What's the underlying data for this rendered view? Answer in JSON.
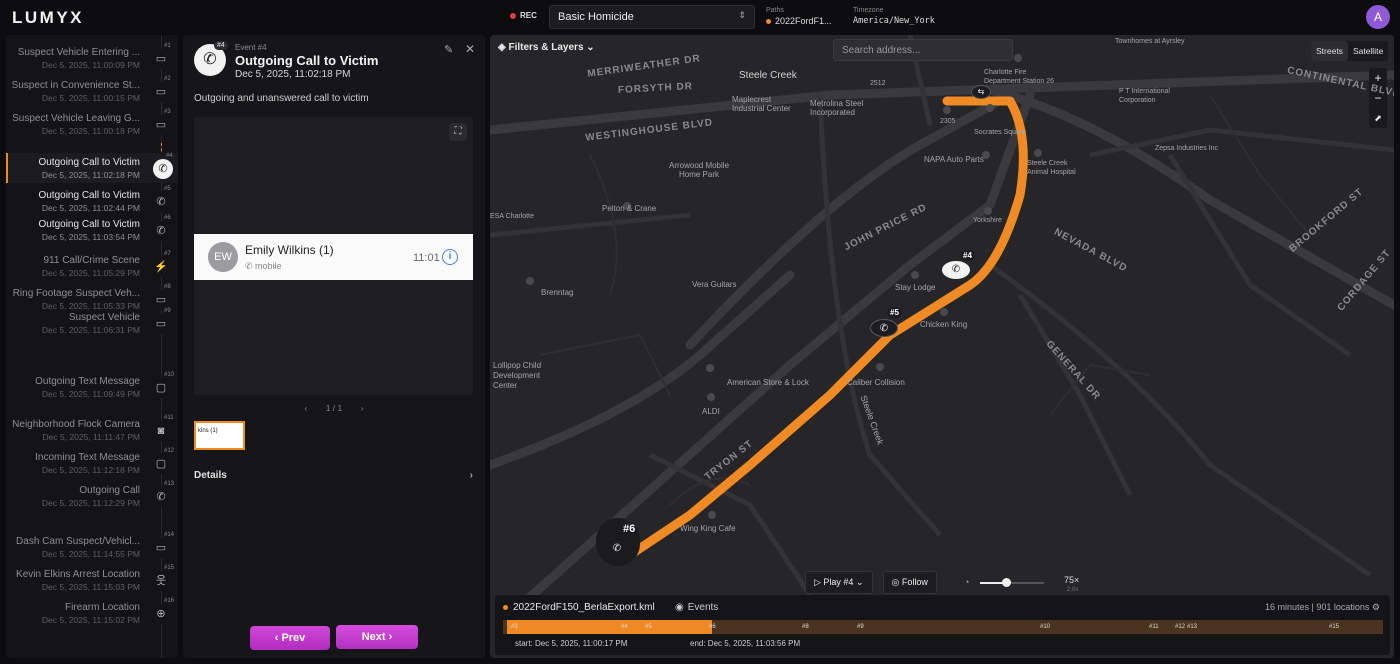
{
  "app": {
    "logo": "LUMYX",
    "rec_label": "REC"
  },
  "case": {
    "selected": "Basic Homicide"
  },
  "paths": {
    "label": "Paths",
    "value": "2022FordF1..."
  },
  "timezone": {
    "label": "Timezone",
    "value": "America/New_York"
  },
  "user": {
    "initial": "A"
  },
  "timeline": {
    "items": [
      {
        "num": "#1",
        "title": "Suspect Vehicle Entering ...",
        "date": "Dec 5, 2025, 11:00:09 PM",
        "icon": "video-icon"
      },
      {
        "num": "#2",
        "title": "Suspect in Convenience St...",
        "date": "Dec 5, 2025, 11:00:15 PM",
        "icon": "video-icon"
      },
      {
        "num": "#3",
        "title": "Suspect Vehicle Leaving G...",
        "date": "Dec 5, 2025, 11:00:18 PM",
        "icon": "video-icon"
      },
      {
        "num": "#4",
        "title": "Outgoing Call to Victim",
        "date": "Dec 5, 2025, 11:02:18 PM",
        "icon": "phone-icon"
      },
      {
        "num": "#5",
        "title": "Outgoing Call to Victim",
        "date": "Dec 5, 2025, 11:02:44 PM",
        "icon": "phone-icon"
      },
      {
        "num": "#6",
        "title": "Outgoing Call to Victim",
        "date": "Dec 5, 2025, 11:03:54 PM",
        "icon": "phone-icon"
      },
      {
        "num": "#7",
        "title": "911 Call/Crime Scene",
        "date": "Dec 5, 2025, 11:05:29 PM",
        "icon": "crime-scene-icon"
      },
      {
        "num": "#8",
        "title": "Ring Footage Suspect Veh...",
        "date": "Dec 5, 2025, 11:05:33 PM",
        "icon": "video-icon"
      },
      {
        "num": "#9",
        "title": "Suspect Vehicle",
        "date": "Dec 5, 2025, 11:06:31 PM",
        "icon": "video-icon"
      },
      {
        "num": "#10",
        "title": "Outgoing Text Message",
        "date": "Dec 5, 2025, 11:09:49 PM",
        "icon": "message-icon"
      },
      {
        "num": "#11",
        "title": "Neighborhood Flock Camera",
        "date": "Dec 5, 2025, 11:11:47 PM",
        "icon": "camera-icon"
      },
      {
        "num": "#12",
        "title": "Incoming Text Message",
        "date": "Dec 5, 2025, 11:12:18 PM",
        "icon": "message-icon"
      },
      {
        "num": "#13",
        "title": "Outgoing Call",
        "date": "Dec 5, 2025, 11:12:29 PM",
        "icon": "phone-icon"
      },
      {
        "num": "#14",
        "title": "Dash Cam Suspect/Vehicl...",
        "date": "Dec 5, 2025, 11:14:55 PM",
        "icon": "video-icon"
      },
      {
        "num": "#15",
        "title": "Kevin Elkins Arrest Location",
        "date": "Dec 5, 2025, 11:15:03 PM",
        "icon": "person-icon"
      },
      {
        "num": "#16",
        "title": "Firearm Location",
        "date": "Dec 5, 2025, 11:15:02 PM",
        "icon": "crosshair-icon"
      }
    ]
  },
  "detail": {
    "badge": "#4",
    "label": "Event #4",
    "title": "Outgoing Call to Victim",
    "date": "Dec 5, 2025, 11:02:18 PM",
    "description": "Outgoing and unanswered call to victim",
    "contact": {
      "initials": "EW",
      "name": "Emily Wilkins (1)",
      "sub": "mobile",
      "time": "11:01"
    },
    "pager": "1 / 1",
    "thumb_label": "kins (1)",
    "details_label": "Details",
    "prev_label": "Prev",
    "next_label": "Next"
  },
  "map": {
    "filters_label": "Filters & Layers",
    "search_placeholder": "Search address...",
    "toggle": [
      "Streets",
      "Satellite"
    ],
    "streets": [
      "MERRIWEATHER DR",
      "FORSYTH DR",
      "WESTINGHOUSE BLVD",
      "JOHN PRICE RD",
      "CONTINENTAL BLVD",
      "NEVADA BLVD",
      "BROOKFORD ST",
      "CORDAGE ST",
      "GENERAL DR",
      "Steele Creek",
      "TRYON ST"
    ],
    "places": [
      "Steele Creek",
      "Maplecrest Industrial Center",
      "Metrolina Steel Incorporated",
      "Charlotte Fire Department Station 26",
      "Socrates Square",
      "NAPA Auto Parts",
      "Steele Creek Animal Hospital",
      "Arrowood Mobile Home Park",
      "Pelton & Crane",
      "Yorkshire",
      "Stay Lodge",
      "Chicken King",
      "Vera Guitars",
      "Brenntag",
      "Lollipop Child Development Center",
      "American Store & Lock",
      "Caliber Collision",
      "ALDI",
      "Wing King Cafe",
      "P T International Corporation",
      "Zepsa Industries Inc",
      "Townhomes at Ayrsley",
      "2512",
      "2305",
      "ESA Charlotte"
    ],
    "markers": [
      "#4",
      "#5",
      "#6"
    ],
    "play_label": "Play #4",
    "follow_label": "Follow",
    "speed": "75×",
    "speed_sub": "2.0s"
  },
  "track": {
    "file": "2022FordF150_BerlaExport.kml",
    "events_label": "Events",
    "duration": "16 minutes",
    "locations": "901 locations",
    "start": "start: Dec 5, 2025, 11:00:17 PM",
    "end": "end: Dec 5, 2025, 11:03:56 PM",
    "ticks": [
      "#3",
      "#4",
      "#5",
      "#6",
      "#8",
      "#9",
      "#10",
      "#11",
      "#12",
      "#13",
      "#15"
    ],
    "colors": {
      "accent": "#f08a24",
      "brand_button": "#c23bd0"
    }
  }
}
